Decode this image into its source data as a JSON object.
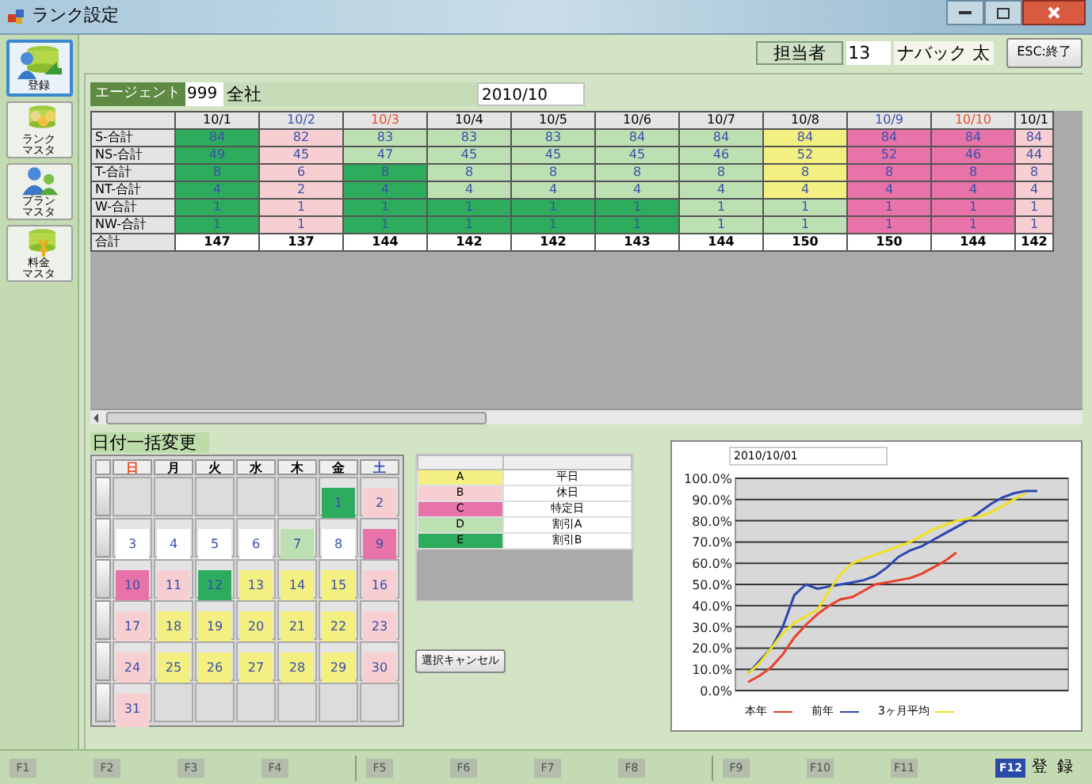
{
  "window": {
    "title": "ランク設定"
  },
  "sidebar": {
    "items": [
      {
        "lines": [
          "登録"
        ],
        "selected": true
      },
      {
        "lines": [
          "ランク",
          "マスタ"
        ],
        "selected": false
      },
      {
        "lines": [
          "プラン",
          "マスタ"
        ],
        "selected": false
      },
      {
        "lines": [
          "料金",
          "マスタ"
        ],
        "selected": false
      }
    ]
  },
  "staff": {
    "label": "担当者",
    "code": "13",
    "name": "ナバック 太"
  },
  "exit_button": "ESC:終了",
  "agent": {
    "label": "エージェント",
    "code": "999",
    "name": "全社",
    "month": "2010/10"
  },
  "grid": {
    "columns": [
      {
        "label": "10/1",
        "color": "#000000"
      },
      {
        "label": "10/2",
        "color": "#3a4fb0"
      },
      {
        "label": "10/3",
        "color": "#e8502c"
      },
      {
        "label": "10/4",
        "color": "#000000"
      },
      {
        "label": "10/5",
        "color": "#000000"
      },
      {
        "label": "10/6",
        "color": "#000000"
      },
      {
        "label": "10/7",
        "color": "#000000"
      },
      {
        "label": "10/8",
        "color": "#000000"
      },
      {
        "label": "10/9",
        "color": "#3a4fb0"
      },
      {
        "label": "10/10",
        "color": "#e8502c"
      },
      {
        "label": "10/1",
        "color": "#000000"
      }
    ],
    "rows": [
      {
        "label": "S-合計",
        "cells": [
          {
            "value": "84",
            "color": "#2eac5e"
          },
          {
            "value": "82",
            "color": "#f7cfd3"
          },
          {
            "value": "83",
            "color": "#bde0b2"
          },
          {
            "value": "83",
            "color": "#bde0b2"
          },
          {
            "value": "83",
            "color": "#bde0b2"
          },
          {
            "value": "84",
            "color": "#bde0b2"
          },
          {
            "value": "84",
            "color": "#bde0b2"
          },
          {
            "value": "84",
            "color": "#f3f081"
          },
          {
            "value": "84",
            "color": "#e873a8"
          },
          {
            "value": "84",
            "color": "#e873a8"
          },
          {
            "value": "84",
            "color": "#f7cfd3"
          }
        ]
      },
      {
        "label": "NS-合計",
        "cells": [
          {
            "value": "49",
            "color": "#2eac5e"
          },
          {
            "value": "45",
            "color": "#f7cfd3"
          },
          {
            "value": "47",
            "color": "#bde0b2"
          },
          {
            "value": "45",
            "color": "#bde0b2"
          },
          {
            "value": "45",
            "color": "#bde0b2"
          },
          {
            "value": "45",
            "color": "#bde0b2"
          },
          {
            "value": "46",
            "color": "#bde0b2"
          },
          {
            "value": "52",
            "color": "#f3f081"
          },
          {
            "value": "52",
            "color": "#e873a8"
          },
          {
            "value": "46",
            "color": "#e873a8"
          },
          {
            "value": "44",
            "color": "#f7cfd3"
          }
        ]
      },
      {
        "label": "T-合計",
        "cells": [
          {
            "value": "8",
            "color": "#2eac5e"
          },
          {
            "value": "6",
            "color": "#f7cfd3"
          },
          {
            "value": "8",
            "color": "#2eac5e"
          },
          {
            "value": "8",
            "color": "#bde0b2"
          },
          {
            "value": "8",
            "color": "#bde0b2"
          },
          {
            "value": "8",
            "color": "#bde0b2"
          },
          {
            "value": "8",
            "color": "#bde0b2"
          },
          {
            "value": "8",
            "color": "#f3f081"
          },
          {
            "value": "8",
            "color": "#e873a8"
          },
          {
            "value": "8",
            "color": "#e873a8"
          },
          {
            "value": "8",
            "color": "#f7cfd3"
          }
        ]
      },
      {
        "label": "NT-合計",
        "cells": [
          {
            "value": "4",
            "color": "#2eac5e"
          },
          {
            "value": "2",
            "color": "#f7cfd3"
          },
          {
            "value": "4",
            "color": "#2eac5e"
          },
          {
            "value": "4",
            "color": "#bde0b2"
          },
          {
            "value": "4",
            "color": "#bde0b2"
          },
          {
            "value": "4",
            "color": "#bde0b2"
          },
          {
            "value": "4",
            "color": "#bde0b2"
          },
          {
            "value": "4",
            "color": "#f3f081"
          },
          {
            "value": "4",
            "color": "#e873a8"
          },
          {
            "value": "4",
            "color": "#e873a8"
          },
          {
            "value": "4",
            "color": "#f7cfd3"
          }
        ]
      },
      {
        "label": "W-合計",
        "cells": [
          {
            "value": "1",
            "color": "#2eac5e"
          },
          {
            "value": "1",
            "color": "#f7cfd3"
          },
          {
            "value": "1",
            "color": "#2eac5e"
          },
          {
            "value": "1",
            "color": "#2eac5e"
          },
          {
            "value": "1",
            "color": "#2eac5e"
          },
          {
            "value": "1",
            "color": "#2eac5e"
          },
          {
            "value": "1",
            "color": "#bde0b2"
          },
          {
            "value": "1",
            "color": "#bde0b2"
          },
          {
            "value": "1",
            "color": "#e873a8"
          },
          {
            "value": "1",
            "color": "#e873a8"
          },
          {
            "value": "1",
            "color": "#f7cfd3"
          }
        ]
      },
      {
        "label": "NW-合計",
        "cells": [
          {
            "value": "1",
            "color": "#2eac5e"
          },
          {
            "value": "1",
            "color": "#f7cfd3"
          },
          {
            "value": "1",
            "color": "#2eac5e"
          },
          {
            "value": "1",
            "color": "#2eac5e"
          },
          {
            "value": "1",
            "color": "#2eac5e"
          },
          {
            "value": "1",
            "color": "#2eac5e"
          },
          {
            "value": "1",
            "color": "#bde0b2"
          },
          {
            "value": "1",
            "color": "#bde0b2"
          },
          {
            "value": "1",
            "color": "#e873a8"
          },
          {
            "value": "1",
            "color": "#e873a8"
          },
          {
            "value": "1",
            "color": "#f7cfd3"
          }
        ]
      }
    ],
    "total": {
      "label": "合計",
      "values": [
        "147",
        "137",
        "144",
        "142",
        "142",
        "143",
        "144",
        "150",
        "150",
        "144",
        "142"
      ]
    }
  },
  "calendar": {
    "title": "日付一括変更",
    "weekdays": [
      {
        "label": "日",
        "color": "#e8502c"
      },
      {
        "label": "月",
        "color": "#000000"
      },
      {
        "label": "火",
        "color": "#000000"
      },
      {
        "label": "水",
        "color": "#000000"
      },
      {
        "label": "木",
        "color": "#000000"
      },
      {
        "label": "金",
        "color": "#000000"
      },
      {
        "label": "土",
        "color": "#3a4fb0"
      }
    ],
    "weeks": [
      [
        {
          "kind": "blank"
        },
        {
          "kind": "blank"
        },
        {
          "kind": "blank"
        },
        {
          "kind": "blank"
        },
        {
          "kind": "blank"
        },
        {
          "kind": "day",
          "day": "1",
          "color": "#2eac5e"
        },
        {
          "kind": "day",
          "day": "2",
          "color": "#f7cfd3"
        }
      ],
      [
        {
          "kind": "day",
          "day": "3",
          "color": "#ffffff"
        },
        {
          "kind": "day",
          "day": "4",
          "color": "#ffffff"
        },
        {
          "kind": "day",
          "day": "5",
          "color": "#ffffff"
        },
        {
          "kind": "day",
          "day": "6",
          "color": "#ffffff"
        },
        {
          "kind": "day",
          "day": "7",
          "color": "#bde0b2"
        },
        {
          "kind": "day",
          "day": "8",
          "color": "#ffffff"
        },
        {
          "kind": "day",
          "day": "9",
          "color": "#e873a8"
        }
      ],
      [
        {
          "kind": "day",
          "day": "10",
          "color": "#e873a8"
        },
        {
          "kind": "day",
          "day": "11",
          "color": "#f7cfd3"
        },
        {
          "kind": "day",
          "day": "12",
          "color": "#2eac5e"
        },
        {
          "kind": "day",
          "day": "13",
          "color": "#f3f081"
        },
        {
          "kind": "day",
          "day": "14",
          "color": "#f3f081"
        },
        {
          "kind": "day",
          "day": "15",
          "color": "#f3f081"
        },
        {
          "kind": "day",
          "day": "16",
          "color": "#f7cfd3"
        }
      ],
      [
        {
          "kind": "day",
          "day": "17",
          "color": "#f7cfd3"
        },
        {
          "kind": "day",
          "day": "18",
          "color": "#f3f081"
        },
        {
          "kind": "day",
          "day": "19",
          "color": "#f3f081"
        },
        {
          "kind": "day",
          "day": "20",
          "color": "#f3f081"
        },
        {
          "kind": "day",
          "day": "21",
          "color": "#f3f081"
        },
        {
          "kind": "day",
          "day": "22",
          "color": "#f3f081"
        },
        {
          "kind": "day",
          "day": "23",
          "color": "#f7cfd3"
        }
      ],
      [
        {
          "kind": "day",
          "day": "24",
          "color": "#f7cfd3"
        },
        {
          "kind": "day",
          "day": "25",
          "color": "#f3f081"
        },
        {
          "kind": "day",
          "day": "26",
          "color": "#f3f081"
        },
        {
          "kind": "day",
          "day": "27",
          "color": "#f3f081"
        },
        {
          "kind": "day",
          "day": "28",
          "color": "#f3f081"
        },
        {
          "kind": "day",
          "day": "29",
          "color": "#f3f081"
        },
        {
          "kind": "day",
          "day": "30",
          "color": "#f7cfd3"
        }
      ],
      [
        {
          "kind": "day",
          "day": "31",
          "color": "#f7cfd3"
        },
        {
          "kind": "blank"
        },
        {
          "kind": "blank"
        },
        {
          "kind": "blank"
        },
        {
          "kind": "blank"
        },
        {
          "kind": "blank"
        },
        {
          "kind": "blank"
        }
      ]
    ]
  },
  "legend": {
    "rows": [
      {
        "code": "A",
        "name": "平日",
        "color": "#f3f081"
      },
      {
        "code": "B",
        "name": "休日",
        "color": "#f7cfd3"
      },
      {
        "code": "C",
        "name": "特定日",
        "color": "#e873a8"
      },
      {
        "code": "D",
        "name": "割引A",
        "color": "#bde0b2"
      },
      {
        "code": "E",
        "name": "割引B",
        "color": "#2eac5e"
      }
    ]
  },
  "cancel_button": "選択キャンセル",
  "chart": {
    "date": "2010/10/01",
    "chart_data": {
      "type": "line",
      "grid": true,
      "ylim": [
        0,
        100
      ],
      "yticks": [
        {
          "value": 0,
          "label": "0.0%"
        },
        {
          "value": 10,
          "label": "10.0%"
        },
        {
          "value": 20,
          "label": "20.0%"
        },
        {
          "value": 30,
          "label": "30.0%"
        },
        {
          "value": 40,
          "label": "40.0%"
        },
        {
          "value": 50,
          "label": "50.0%"
        },
        {
          "value": 60,
          "label": "60.0%"
        },
        {
          "value": 70,
          "label": "70.0%"
        },
        {
          "value": 80,
          "label": "80.0%"
        },
        {
          "value": 90,
          "label": "90.0%"
        },
        {
          "value": 100,
          "label": "100.0%"
        }
      ],
      "series": [
        {
          "name": "本年",
          "color": "#e8402c",
          "values": [
            4,
            7,
            11,
            17,
            25,
            31,
            36,
            40,
            43,
            44,
            47,
            50,
            51,
            52,
            53,
            55,
            58,
            61,
            65,
            null,
            null,
            null,
            null,
            null,
            null,
            null
          ]
        },
        {
          "name": "前年",
          "color": "#2c48b0",
          "values": [
            8,
            14,
            20,
            30,
            45,
            50,
            48,
            49,
            50,
            51,
            52,
            54,
            58,
            63,
            66,
            68,
            71,
            74,
            77,
            80,
            84,
            88,
            91,
            93,
            94,
            94
          ]
        },
        {
          "name": "3ヶ月平均",
          "color": "#f0e020",
          "values": [
            8,
            13,
            20,
            27,
            32,
            35,
            38,
            47,
            55,
            60,
            62,
            64,
            66,
            68,
            70,
            73,
            76,
            78,
            80,
            81,
            82,
            84,
            87,
            90,
            93,
            null
          ]
        }
      ]
    }
  },
  "function_keys": [
    {
      "label": "F1",
      "disabled": true
    },
    {
      "label": "F2",
      "disabled": true
    },
    {
      "label": "F3",
      "disabled": true
    },
    {
      "label": "F4",
      "disabled": true
    },
    {
      "label": "F5",
      "disabled": true
    },
    {
      "label": "F6",
      "disabled": true
    },
    {
      "label": "F7",
      "disabled": true
    },
    {
      "label": "F8",
      "disabled": true
    },
    {
      "label": "F9",
      "disabled": true
    },
    {
      "label": "F10",
      "disabled": true
    },
    {
      "label": "F11",
      "disabled": true
    },
    {
      "label": "F12",
      "disabled": false,
      "action": "登録"
    }
  ]
}
